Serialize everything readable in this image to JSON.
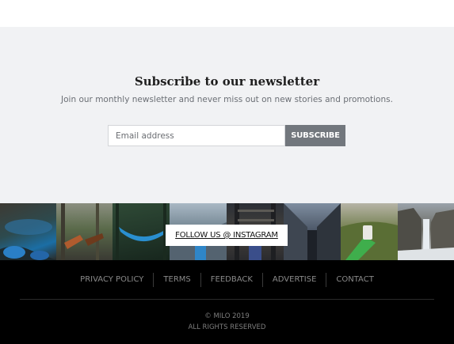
{
  "newsletter": {
    "title": "Subscribe to our newsletter",
    "subtitle": "Join our monthly newsletter and never miss out on new stories and promotions.",
    "email_placeholder": "Email address",
    "subscribe_label": "SUBSCRIBE"
  },
  "instagram": {
    "badge_label": "FOLLOW US @ INSTAGRAM",
    "photos": [
      "lake-photo",
      "forest-feet-photo",
      "hammock-photo",
      "hiker-photo",
      "bridge-photo",
      "train-photo",
      "phone-photo",
      "waterfall-photo"
    ]
  },
  "footer": {
    "links": [
      "PRIVACY POLICY",
      "TERMS",
      "FEEDBACK",
      "ADVERTISE",
      "CONTACT"
    ],
    "copyright": "© MILO 2019",
    "rights": "ALL RIGHTS RESERVED"
  }
}
